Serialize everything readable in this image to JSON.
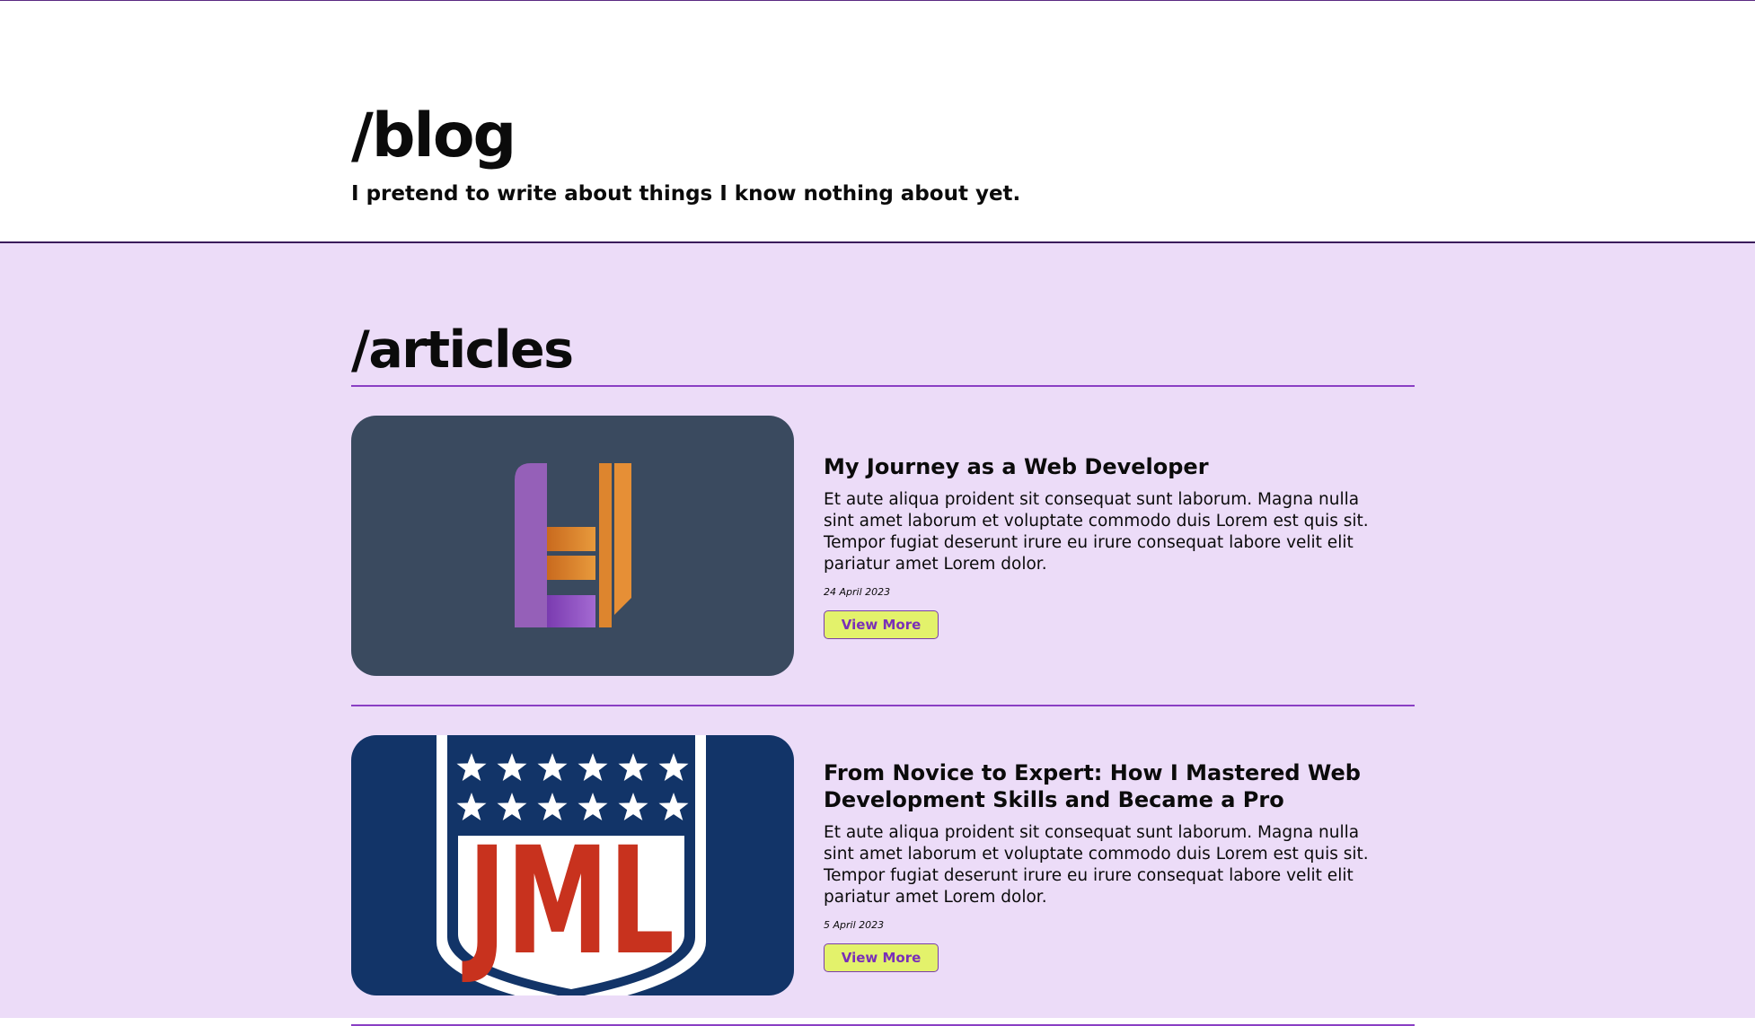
{
  "header": {
    "title": "/blog",
    "subtitle": "I pretend to write about things I know nothing about yet."
  },
  "articles_section": {
    "title": "/articles",
    "items": [
      {
        "title": "My Journey as a Web Developer",
        "excerpt": "Et aute aliqua proident sit consequat sunt laborum. Magna nulla sint amet laborum et voluptate commodo duis Lorem est quis sit. Tempor fugiat deserunt irure eu irure consequat labore velit elit pariatur amet Lorem dolor.",
        "date": "24 April 2023",
        "button_label": "View More",
        "thumbnail": "h-logo-image",
        "thumbnail_bg": "#3a4a5f"
      },
      {
        "title": "From Novice to Expert: How I Mastered Web Development Skills and Became a Pro",
        "excerpt": "Et aute aliqua proident sit consequat sunt laborum. Magna nulla sint amet laborum et voluptate commodo duis Lorem est quis sit. Tempor fugiat deserunt irure eu irure consequat labore velit elit pariatur amet Lorem dolor.",
        "date": "5 April 2023",
        "button_label": "View More",
        "thumbnail": "jml-shield-image",
        "thumbnail_text": "JML",
        "thumbnail_bg": "#123468"
      }
    ]
  },
  "colors": {
    "accent_purple": "#8a3fc4",
    "section_bg": "#ecdcf8",
    "button_bg": "#e3f26b",
    "button_text": "#7a2fb8"
  }
}
